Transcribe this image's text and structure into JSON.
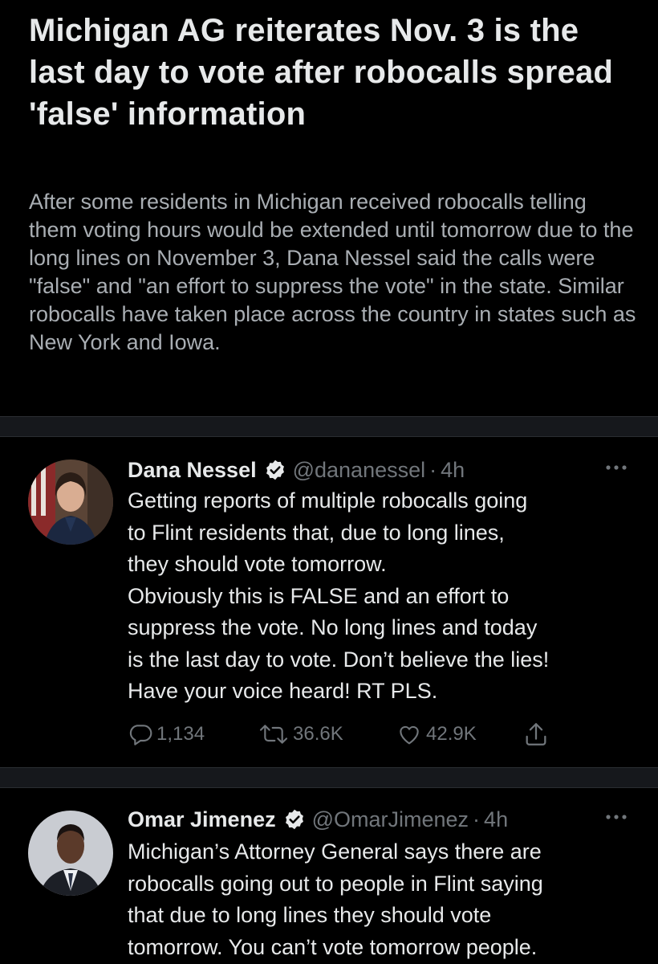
{
  "article": {
    "headline": "Michigan AG reiterates Nov. 3 is the last day to vote after robocalls spread 'false' information",
    "summary": "After some residents in Michigan received robocalls telling them voting hours would be extended until tomorrow due to the long lines on November 3, Dana Nessel said the calls were \"false\" and \"an effort to suppress the vote\" in the state. Similar robocalls have taken place across the country in states such as New York and Iowa."
  },
  "tweets": [
    {
      "name": "Dana Nessel",
      "handle": "@dananessel",
      "separator": "·",
      "time": "4h",
      "lines": [
        "Getting reports of multiple robocalls going",
        "to Flint residents that, due to long lines,",
        "they should vote tomorrow.",
        "Obviously this is FALSE and an effort to",
        "suppress the vote. No long lines and today",
        "is the last day to vote. Don’t believe the lies!",
        "Have your voice heard! RT PLS."
      ],
      "replies": "1,134",
      "retweets": "36.6K",
      "likes": "42.9K"
    },
    {
      "name": "Omar Jimenez",
      "handle": "@OmarJimenez",
      "separator": "·",
      "time": "4h",
      "lines": [
        "Michigan’s Attorney General says there are",
        "robocalls going out to people in Flint saying",
        "that due to long lines they should vote",
        "tomorrow. You can’t vote tomorrow people."
      ]
    }
  ],
  "icons": {
    "verified": "verified-badge-icon",
    "more": "more-options-icon",
    "reply": "reply-icon",
    "retweet": "retweet-icon",
    "like": "like-icon",
    "share": "share-icon"
  },
  "colors": {
    "background": "#000000",
    "text": "#e7e9ea",
    "secondary": "#71767b",
    "divider": "#16181c"
  }
}
